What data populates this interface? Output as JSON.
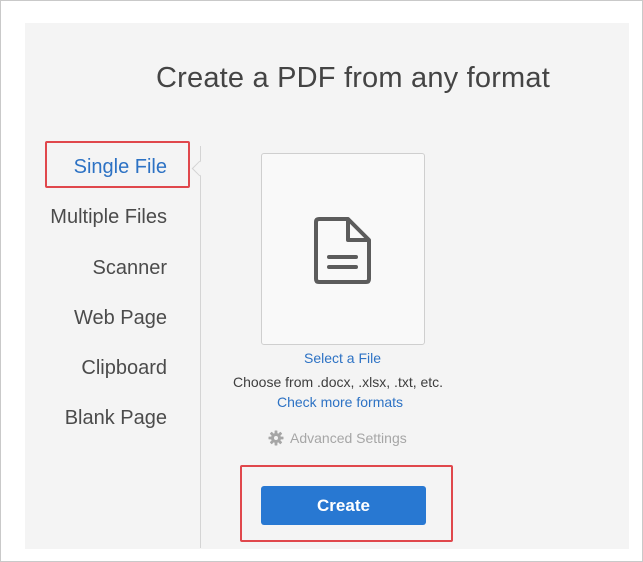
{
  "page": {
    "title": "Create a PDF from any format"
  },
  "sidebar": {
    "items": [
      {
        "label": "Single File",
        "active": true
      },
      {
        "label": "Multiple Files",
        "active": false
      },
      {
        "label": "Scanner",
        "active": false
      },
      {
        "label": "Web Page",
        "active": false
      },
      {
        "label": "Clipboard",
        "active": false
      },
      {
        "label": "Blank Page",
        "active": false
      }
    ]
  },
  "main": {
    "drop_zone_icon": "document-icon",
    "select_file_label": "Select a File",
    "formats_hint": "Choose from .docx, .xlsx, .txt, etc.",
    "more_formats_link": "Check more formats",
    "advanced_settings_label": "Advanced Settings",
    "advanced_settings_icon": "gear-icon",
    "create_button_label": "Create"
  },
  "colors": {
    "accent": "#2878d2",
    "link": "#2d72c4",
    "highlight": "#e0474c",
    "panel_bg": "#f4f4f4"
  }
}
